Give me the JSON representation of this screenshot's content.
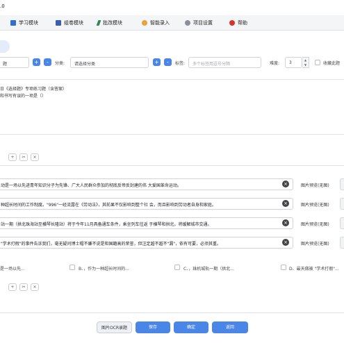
{
  "window": {
    "title": ".0"
  },
  "menu": [
    {
      "label": "学习模块",
      "icon": "grid-icon",
      "color": "#2f6fd6"
    },
    {
      "label": "组卷模块",
      "icon": "list-icon",
      "color": "#3a5fb0"
    },
    {
      "label": "批改模块",
      "icon": "pen-icon",
      "color": "#2e8b57"
    },
    {
      "label": "智能录入",
      "icon": "spark-icon",
      "color": "#e6a23c"
    },
    {
      "label": "项目设置",
      "icon": "gear-icon",
      "color": "#8a8f99"
    },
    {
      "label": "帮助",
      "icon": "help-icon",
      "color": "#d9342b"
    }
  ],
  "form": {
    "category_value": "题",
    "category_label": "分类:",
    "category_placeholder": "请选择分类",
    "tags_label": "标签:",
    "tags_placeholder": "多个标签用逗号分隔",
    "difficulty_label": "难度:",
    "difficulty_value": "3",
    "favorite_label": "收藏此题"
  },
  "question": {
    "line1": "日《选择题》专项练习题（含答案）",
    "line2": "和书写有误的一项是（）"
  },
  "toolbar_icons": [
    "plus-icon",
    "cut-icon",
    "close-icon"
  ],
  "options": [
    {
      "text": "动是一场以先进青年知识分子为先锋、广大人民群众参加的彻底反帝反封建的伟 大爱国革命运动。",
      "preview": "图片预览(无图)"
    },
    {
      "text": "种超长时间的工作制度。\"996\"一经流露在《劳动法》，其前果不仅影响到整个社 会，而且影响到劳动者自身和家庭。",
      "preview": "图片预览(无图)"
    },
    {
      "text": "站一期（拱北珠海站至横琴长隆站）将于今年11月具备通车条件，乘坐列车往返 于横琴和拱北，将缓解城市交通。",
      "preview": "图片预览(无图)"
    },
    {
      "text": "\"学术打假\"的事件告诉我们，毫无疑问博士帽不嫌不说是和国籍高的荣誉，但注定越不越不\"漏\"，依有可要，必须其重。",
      "preview": "图片预览(无图)"
    }
  ],
  "answers": [
    {
      "text": "是一场以先..."
    },
    {
      "text": "B、，作为一种超长时间的..."
    },
    {
      "text": "C、，珠机城轨一期（拱北..."
    },
    {
      "text": "D、最天做被 \"学术打假\"..."
    }
  ],
  "buttons": {
    "ocr": "图片OCR录题",
    "save": "保存",
    "confirm": "确定",
    "back": "返回"
  }
}
